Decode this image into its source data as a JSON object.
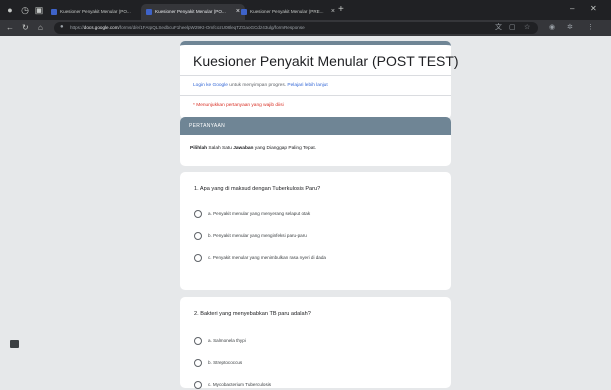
{
  "browser": {
    "tabs": [
      {
        "label": "Kuesioner Penyakit Menular (PO...",
        "active": false
      },
      {
        "label": "Kuesioner Penyakit Menular (PO...",
        "active": true
      },
      {
        "label": "Kuesioner Penyakit Menular (PRE...",
        "active": false
      }
    ],
    "url_prefix": "https://",
    "url_domain": "docs.google.com",
    "url_path": "/forms/d/e/1FAIpQLSedbcuF1heelpW29Kt-OmfcozU08leqTZGaoGCdz43ulg/formResponse",
    "new_tab_symbol": "+",
    "close_symbol": "×"
  },
  "form": {
    "title": "Kuesioner Penyakit Menular (POST TEST)",
    "login_link": "Login ke Google",
    "login_text": " untuk menyimpan progres. ",
    "learn_more": "Pelajari lebih lanjut",
    "required_note": "* Menunjukkan pertanyaan yang wajib diisi",
    "section_title": "PERTANYAAN",
    "instruction_bold1": "Pilihlah",
    "instruction_mid": " Salah Satu ",
    "instruction_bold2": "Jawaban",
    "instruction_end": " yang Dianggap Paling Tepat."
  },
  "questions": [
    {
      "title": "1. Apa yang di maksud dengan Tuberkulosis Paru?",
      "options": [
        "a. Penyakit menular yang menyerang selaput otak",
        "b. Penyakit menular yang menginfeksi paru-paru",
        "c. Penyakit menular yang menimbulkan rasa nyeri di dada"
      ]
    },
    {
      "title": "2. Bakteri yang menyebabkan TB paru adalah?",
      "options": [
        "a. Salmonela thypi",
        "b. Streptococcus",
        "c. Mycobacterium Tuberculosis"
      ]
    }
  ],
  "icons": {
    "feedback": "feedback-icon"
  }
}
